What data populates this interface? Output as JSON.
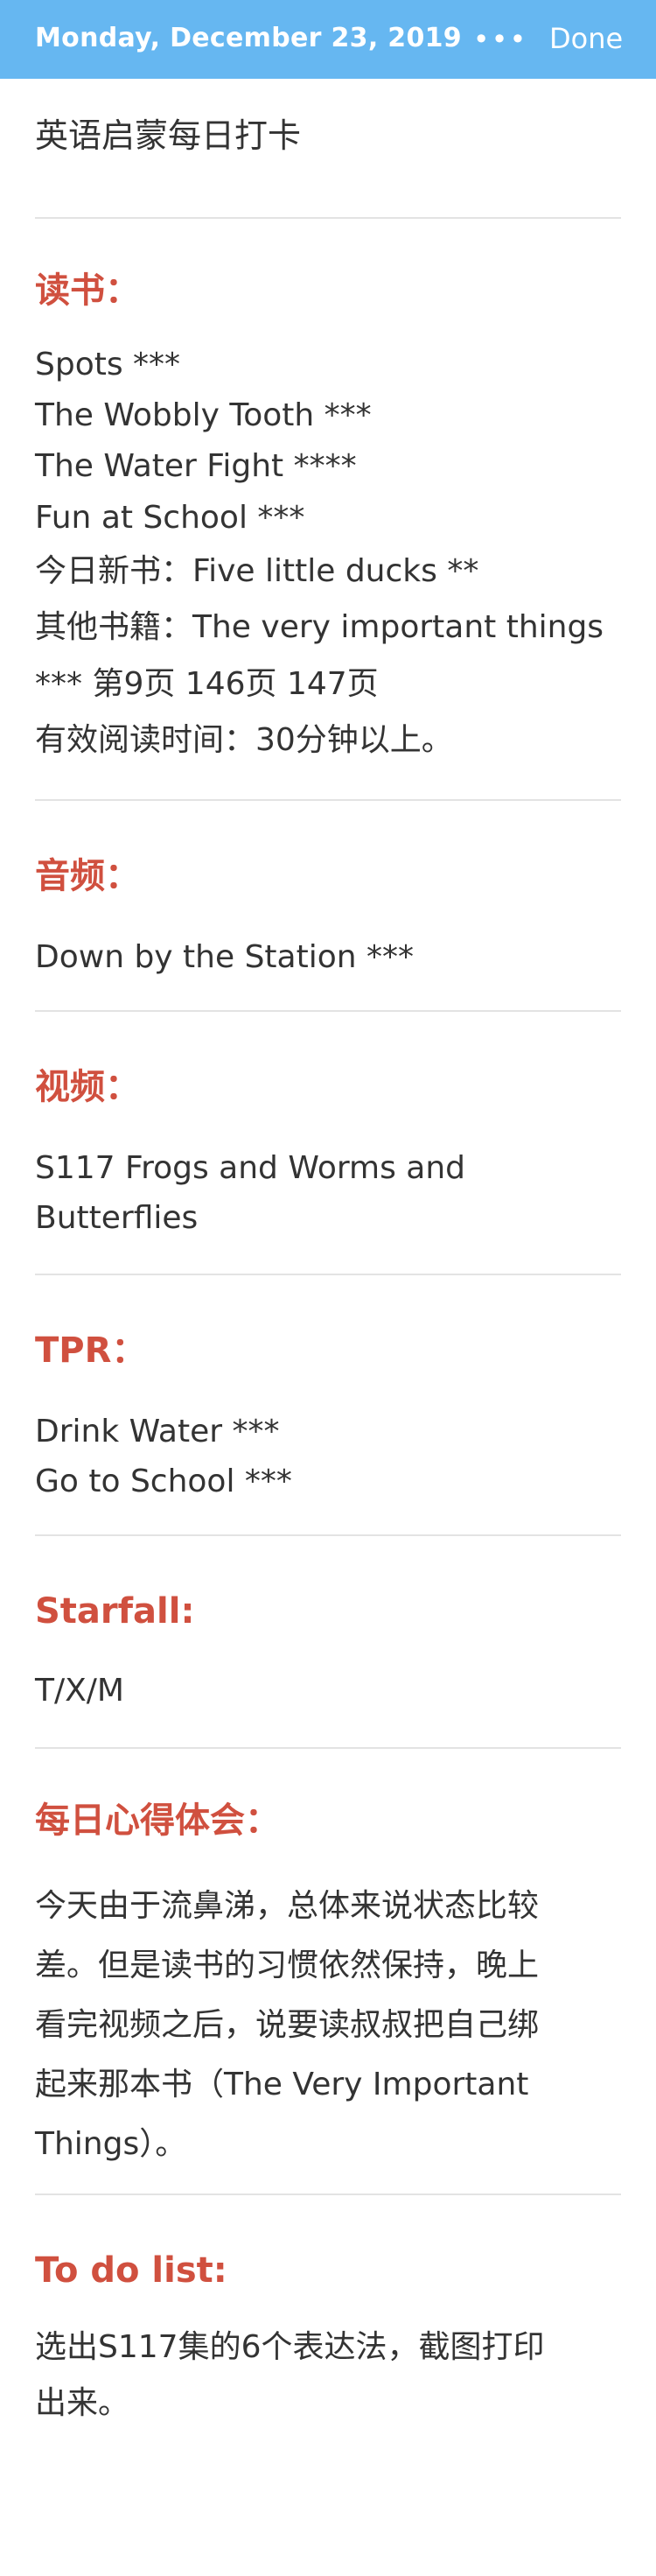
{
  "topbar": {
    "date": "Monday, December 23, 2019",
    "more_label": "•••",
    "done_label": "Done",
    "bar_color": "#66b7f1"
  },
  "note": {
    "title": "英语启蒙每日打卡",
    "accent_color": "#d0503f",
    "sections": {
      "reading": {
        "heading": "读书：",
        "lines": [
          "Spots ***",
          "The Wobbly Tooth ***",
          "The Water Fight ****",
          "Fun at School ***",
          "今日新书：Five little ducks **",
          "其他书籍：The very important things",
          "*** 第9页 146页 147页",
          "有效阅读时间：30分钟以上。"
        ]
      },
      "audio": {
        "heading": "音频：",
        "lines": [
          "Down by the Station ***"
        ]
      },
      "video": {
        "heading": "视频：",
        "lines": [
          "S117 Frogs and Worms and",
          "Butterflies"
        ]
      },
      "tpr": {
        "heading": "TPR：",
        "lines": [
          "Drink Water ***",
          "Go to School ***"
        ]
      },
      "starfall": {
        "heading": "Starfall:",
        "lines": [
          "T/X/M"
        ]
      },
      "reflection": {
        "heading": "每日心得体会：",
        "lines": [
          "今天由于流鼻涕，总体来说状态比较",
          "差。但是读书的习惯依然保持，晚上",
          "看完视频之后，说要读叔叔把自己绑",
          "起来那本书（The Very Important",
          "Things）。"
        ]
      },
      "todo": {
        "heading": "To do list:",
        "lines": [
          "选出S117集的6个表达法，截图打印",
          "出来。"
        ]
      }
    }
  }
}
